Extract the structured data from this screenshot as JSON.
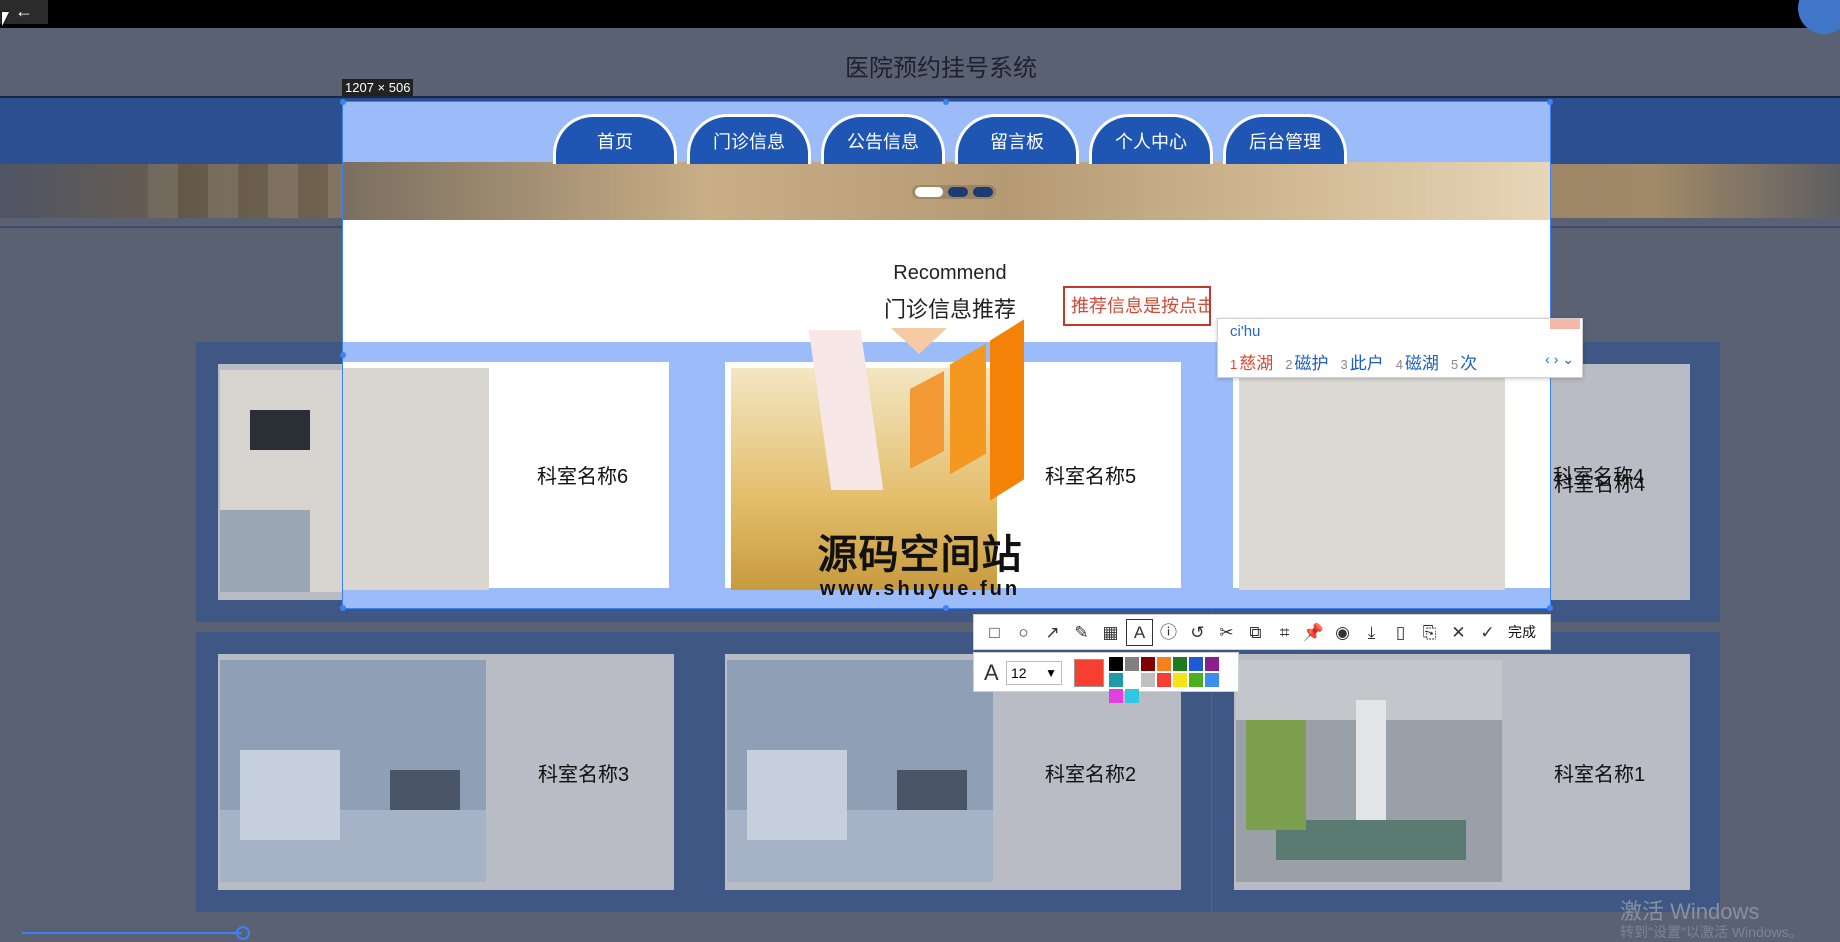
{
  "window": {
    "back_icon": "arrow-left-icon",
    "minimize_label": "–"
  },
  "site": {
    "title": "医院预约挂号系统",
    "nav": [
      "首页",
      "门诊信息",
      "公告信息",
      "留言板",
      "个人中心",
      "后台管理"
    ]
  },
  "screenshot_tool": {
    "selection_size": "1207 × 506",
    "done_label": "完成",
    "font_size": "12",
    "current_color": "#f43f31",
    "palette": [
      "#000000",
      "#808080",
      "#800000",
      "#f6821e",
      "#1e7a1e",
      "#1e5ad4",
      "#8b1e8b",
      "#1e9aa8",
      "#ffffff",
      "#c0c0c0",
      "#f43f31",
      "#f7e21a",
      "#4caf1e",
      "#3b8ef0",
      "#e040e0",
      "#30c8e0"
    ]
  },
  "section": {
    "recommend_en": "Recommend",
    "recommend_cn": "门诊信息推荐"
  },
  "annotation": {
    "text_box_value": "推荐信息是按点击"
  },
  "ime": {
    "input": "ci'hu",
    "candidates": [
      {
        "num": "1",
        "text": "慈湖"
      },
      {
        "num": "2",
        "text": "磁护"
      },
      {
        "num": "3",
        "text": "此户"
      },
      {
        "num": "4",
        "text": "磁湖"
      },
      {
        "num": "5",
        "text": "次"
      }
    ],
    "nav": "‹ › ⌄"
  },
  "departments": [
    {
      "label": "科室名称6"
    },
    {
      "label": "科室名称5"
    },
    {
      "label": "科室名称4"
    },
    {
      "label": "科室名称3"
    },
    {
      "label": "科室名称2"
    },
    {
      "label": "科室名称1"
    }
  ],
  "watermark": {
    "title": "源码空间站",
    "url": "www.shuyue.fun"
  },
  "os": {
    "activate_title": "激活 Windows",
    "activate_sub": "转到\"设置\"以激活 Windows。"
  }
}
